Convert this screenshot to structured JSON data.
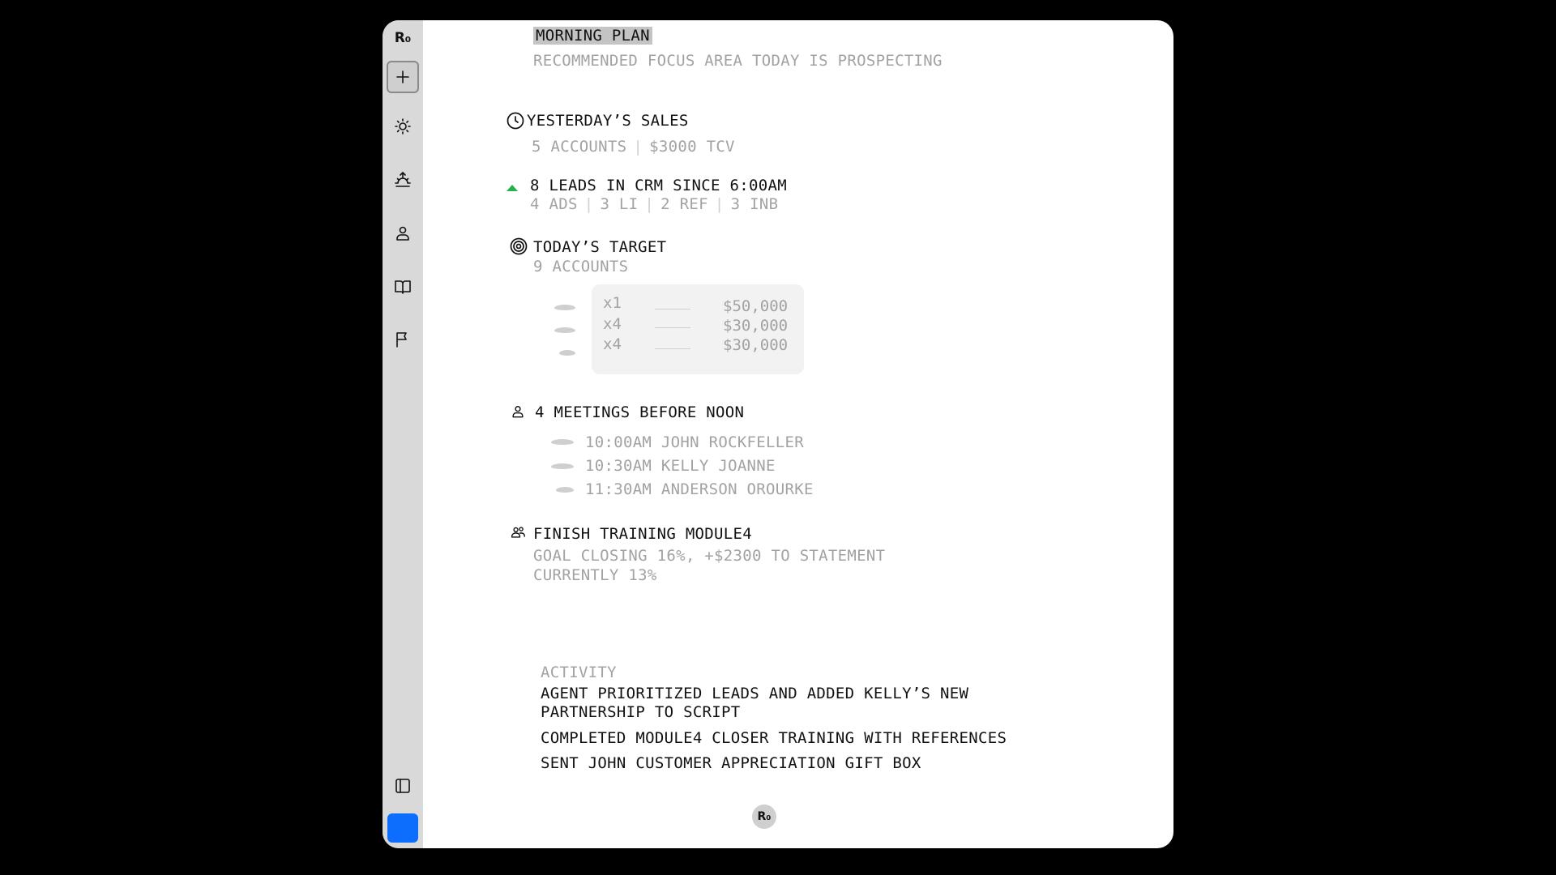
{
  "app": {
    "logo_text": "R₀",
    "badge_text": "R₀"
  },
  "sidebar": {
    "items": [
      {
        "name": "logo"
      },
      {
        "name": "new"
      },
      {
        "name": "sun"
      },
      {
        "name": "sunrise"
      },
      {
        "name": "person"
      },
      {
        "name": "book"
      },
      {
        "name": "flag"
      },
      {
        "name": "panel"
      }
    ],
    "accent_color": "#0d6efd"
  },
  "plan": {
    "title": "MORNING PLAN",
    "subtitle": "RECOMMENDED FOCUS AREA TODAY IS PROSPECTING"
  },
  "sales": {
    "title": "YESTERDAY’S SALES",
    "accounts": "5 ACCOUNTS",
    "tcv": "$3000 TCV"
  },
  "leads": {
    "title": "8 LEADS IN CRM SINCE 6:00AM",
    "trend_color": "#22b14c",
    "breakdown": [
      "4 ADS",
      "3 LI",
      "2 REF",
      "3 INB"
    ]
  },
  "target": {
    "title": "TODAY’S TARGET",
    "subtitle": "9 ACCOUNTS",
    "rows": [
      {
        "mult": "x1",
        "amount": "$50,000"
      },
      {
        "mult": "x4",
        "amount": "$30,000"
      },
      {
        "mult": "x4",
        "amount": "$30,000"
      }
    ]
  },
  "meetings": {
    "title": "4 MEETINGS BEFORE NOON",
    "items": [
      "10:00AM JOHN ROCKFELLER",
      "10:30AM KELLY JOANNE",
      "11:30AM ANDERSON OROURKE"
    ]
  },
  "training": {
    "title": "FINISH TRAINING MODULE4",
    "line1": "GOAL CLOSING 16%, +$2300 TO STATEMENT",
    "line2": "CURRENTLY 13%"
  },
  "activity": {
    "label": "ACTIVITY",
    "items": [
      "AGENT PRIORITIZED LEADS AND ADDED KELLY’S NEW",
      "PARTNERSHIP TO SCRIPT",
      "COMPLETED MODULE4 CLOSER TRAINING WITH REFERENCES",
      "SENT JOHN CUSTOMER APPRECIATION GIFT BOX"
    ]
  }
}
